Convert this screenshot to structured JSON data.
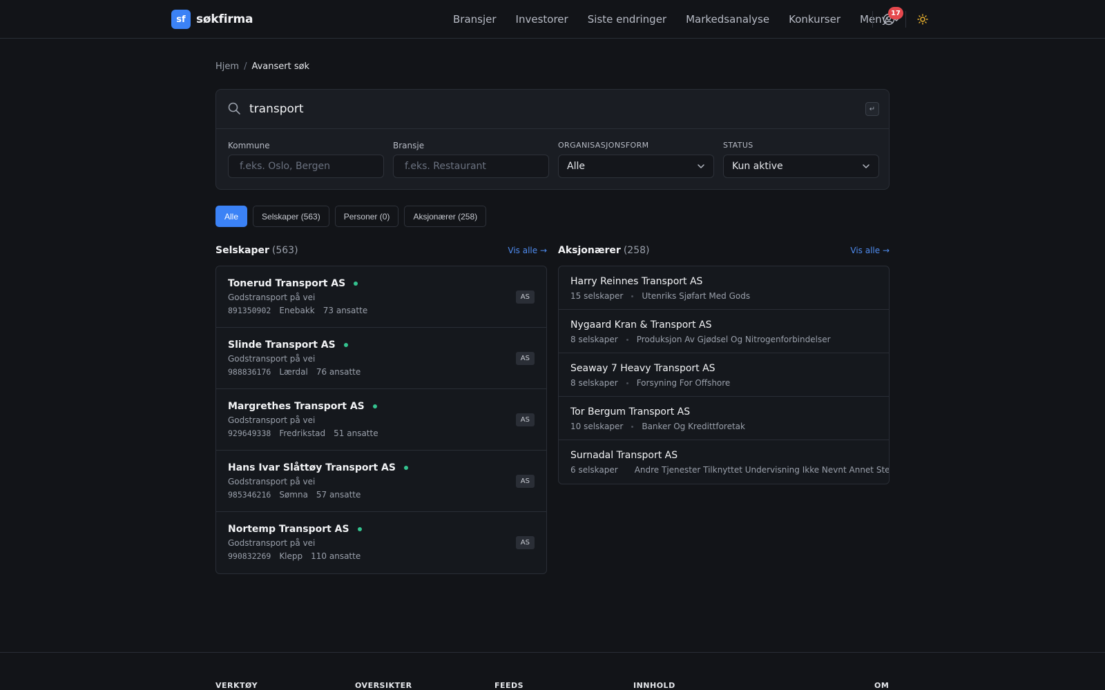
{
  "brand": {
    "logo": "sf",
    "name": "søkfirma"
  },
  "nav": {
    "items": [
      "Bransjer",
      "Investorer",
      "Siste endringer",
      "Markedsanalyse",
      "Konkurser",
      "Meny"
    ],
    "notification_count": "17",
    "icons": [
      "user-circle-icon",
      "sun-icon",
      "chevron-down-icon"
    ]
  },
  "breadcrumb": {
    "home": "Hjem",
    "separator": "/",
    "current": "Avansert søk"
  },
  "search": {
    "query": "transport",
    "enter_hint": "↵",
    "filters": {
      "kommune": {
        "label": "Kommune",
        "placeholder": "f.eks. Oslo, Bergen"
      },
      "bransje": {
        "label": "Bransje",
        "placeholder": "f.eks. Restaurant"
      },
      "orgform": {
        "label": "ORGANISASJONSFORM",
        "value": "Alle"
      },
      "status": {
        "label": "STATUS",
        "value": "Kun aktive"
      }
    }
  },
  "tabs": [
    "Alle",
    "Selskaper (563)",
    "Personer (0)",
    "Aksjonærer (258)"
  ],
  "companies": {
    "title": "Selskaper",
    "count": "(563)",
    "view_all": "Vis alle →",
    "items": [
      {
        "name": "Tonerud Transport AS",
        "industry": "Godstransport på vei",
        "orgnr": "891350902",
        "municipality": "Enebakk",
        "employees": "73 ansatte",
        "tag": "AS"
      },
      {
        "name": "Slinde Transport AS",
        "industry": "Godstransport på vei",
        "orgnr": "988836176",
        "municipality": "Lærdal",
        "employees": "76 ansatte",
        "tag": "AS"
      },
      {
        "name": "Margrethes Transport AS",
        "industry": "Godstransport på vei",
        "orgnr": "929649338",
        "municipality": "Fredrikstad",
        "employees": "51 ansatte",
        "tag": "AS"
      },
      {
        "name": "Hans Ivar Slåttøy Transport AS",
        "industry": "Godstransport på vei",
        "orgnr": "985346216",
        "municipality": "Sømna",
        "employees": "57 ansatte",
        "tag": "AS"
      },
      {
        "name": "Nortemp Transport AS",
        "industry": "Godstransport på vei",
        "orgnr": "990832269",
        "municipality": "Klepp",
        "employees": "110 ansatte",
        "tag": "AS"
      }
    ],
    "active_color": "#34c38f"
  },
  "shareholders": {
    "title": "Aksjonærer",
    "count": "(258)",
    "view_all": "Vis alle →",
    "items": [
      {
        "name": "Harry Reinnes Transport AS",
        "companies": "15 selskaper",
        "industry": "Utenriks Sjøfart Med Gods"
      },
      {
        "name": "Nygaard Kran & Transport AS",
        "companies": "8 selskaper",
        "industry": "Produksjon Av Gjødsel Og Nitrogenforbindelser"
      },
      {
        "name": "Seaway 7 Heavy Transport AS",
        "companies": "8 selskaper",
        "industry": "Forsyning For Offshore"
      },
      {
        "name": "Tor Bergum Transport AS",
        "companies": "10 selskaper",
        "industry": "Banker Og Kredittforetak"
      },
      {
        "name": "Surnadal Transport AS",
        "companies": "6 selskaper",
        "industry": "Andre Tjenester Tilknyttet Undervisning Ikke Nevnt Annet Sted"
      }
    ]
  },
  "footer": {
    "columns": [
      "VERKTØY",
      "OVERSIKTER",
      "FEEDS",
      "INNHOLD",
      "OM"
    ]
  },
  "colors": {
    "accent": "#3b82f6",
    "background": "#121418",
    "badge": "#e5484d"
  }
}
